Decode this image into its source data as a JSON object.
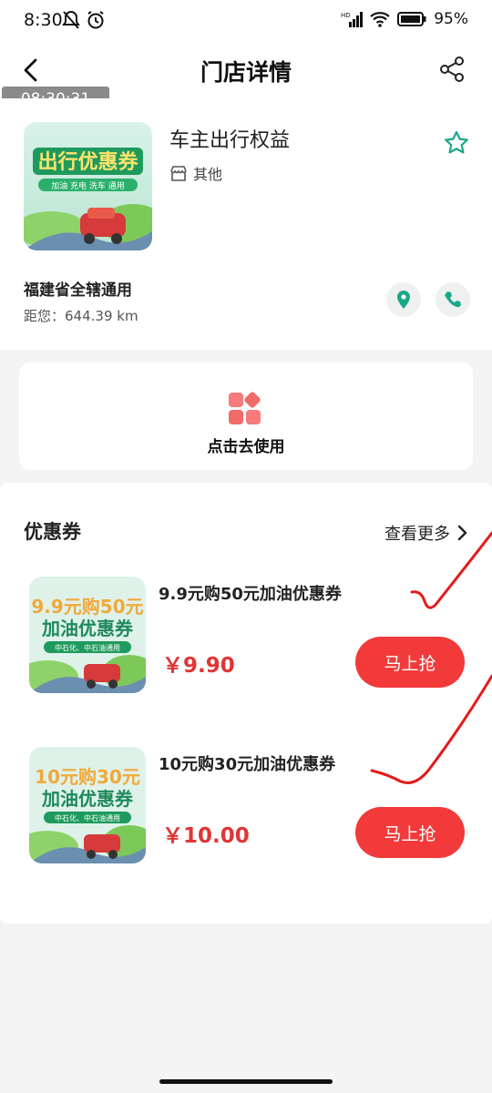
{
  "status_bar": {
    "time": "8:30",
    "battery": "95%",
    "signal_label": "HD"
  },
  "nav": {
    "title": "门店详情",
    "back_icon": "chevron-left-icon",
    "share_icon": "share-icon"
  },
  "timestamp": "08:30:31",
  "store": {
    "name": "车主出行权益",
    "category": "其他",
    "region": "福建省全辖通用",
    "distance": "距您：644.39 km",
    "image": {
      "headline": "出行优惠券",
      "tags": "加油 充电 洗车 通用"
    }
  },
  "use_card": {
    "label": "点击去使用"
  },
  "coupons_section": {
    "title": "优惠券",
    "more_label": "查看更多",
    "items": [
      {
        "title": "9.9元购50元加油优惠券",
        "price": "￥9.90",
        "button": "马上抢",
        "image": {
          "line1": "9.9元购50元",
          "line2": "加油优惠券",
          "tag": "中石化、中石油通用"
        }
      },
      {
        "title": "10元购30元加油优惠券",
        "price": "￥10.00",
        "button": "马上抢",
        "image": {
          "line1": "10元购30元",
          "line2": "加油优惠券",
          "tag": "中石化、中石油通用"
        }
      }
    ]
  },
  "colors": {
    "accent_green": "#1aa88a",
    "price_red": "#e03535",
    "button_red": "#f23a3a",
    "annotation_red": "#e31b1b"
  }
}
